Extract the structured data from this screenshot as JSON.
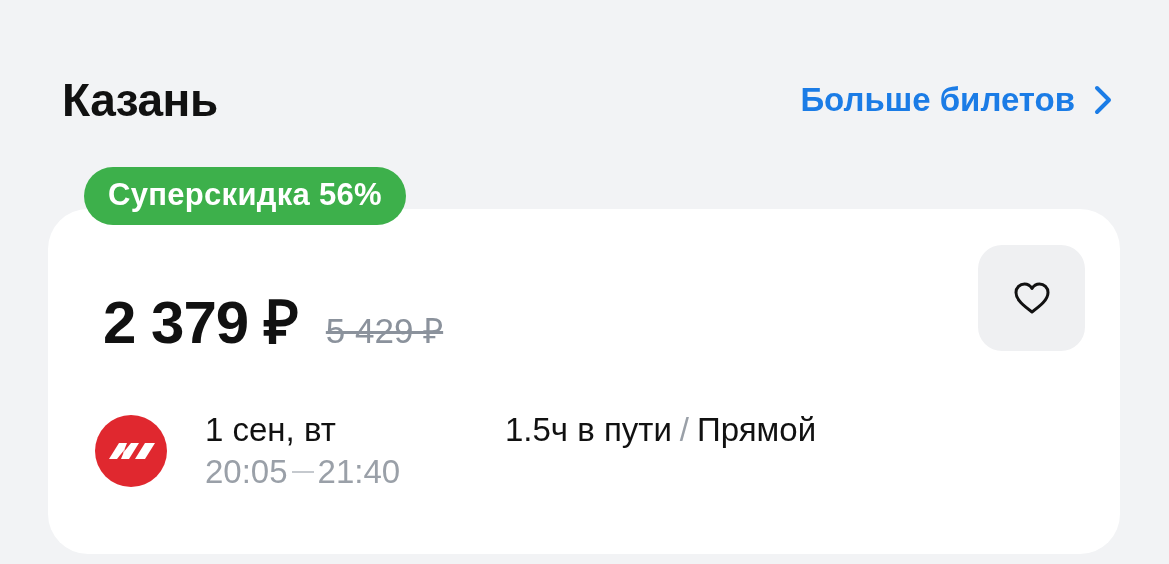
{
  "header": {
    "title": "Казань",
    "more_link": "Больше билетов"
  },
  "ticket": {
    "badge": "Суперскидка 56%",
    "price": "2 379 ₽",
    "old_price": "5 429 ₽",
    "favorite": false,
    "flight": {
      "date": "1 сен, вт",
      "depart": "20:05",
      "arrive": "21:40",
      "duration": "1.5ч в пути",
      "separator": "/",
      "route_type": "Прямой"
    }
  }
}
